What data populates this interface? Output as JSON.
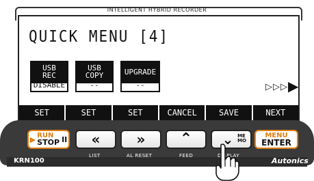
{
  "device": {
    "header": "INTELLIGENT HYBRID RECORDER",
    "model": "KRN100",
    "brand": "Autonics"
  },
  "screen": {
    "title": "QUICK MENU [4]",
    "cells": [
      {
        "head": "USB\nREC",
        "value": "DISABLE"
      },
      {
        "head": "USB\nCOPY",
        "value": "--"
      },
      {
        "head": "UPGRADE",
        "value": "--"
      }
    ],
    "more_indicator": "▷▷▷",
    "more_indicator_big": "▶",
    "softkeys": [
      "SET",
      "SET",
      "SET",
      "CANCEL",
      "SAVE",
      "NEXT"
    ]
  },
  "buttons": {
    "run_top": "RUN",
    "run_bottom": "STOP",
    "run_pause_glyph": "II",
    "list_glyph": "«",
    "list_label": "LIST",
    "alreset_glyph": "»",
    "alreset_label": "AL RESET",
    "feed_glyph": "⌃",
    "feed_label": "FEED",
    "memo_glyph": "⌄",
    "memo_sub_top": "ME",
    "memo_sub_bottom": "MO",
    "display_label": "DISPLAY",
    "menu_top": "MENU",
    "menu_bottom": "ENTER"
  },
  "colors": {
    "accent": "#e07f12",
    "body": "#3a3a3a",
    "lcd_ink": "#111111"
  },
  "icons": {
    "more": "arrow-right-icon",
    "hand": "pointing-hand-icon"
  }
}
